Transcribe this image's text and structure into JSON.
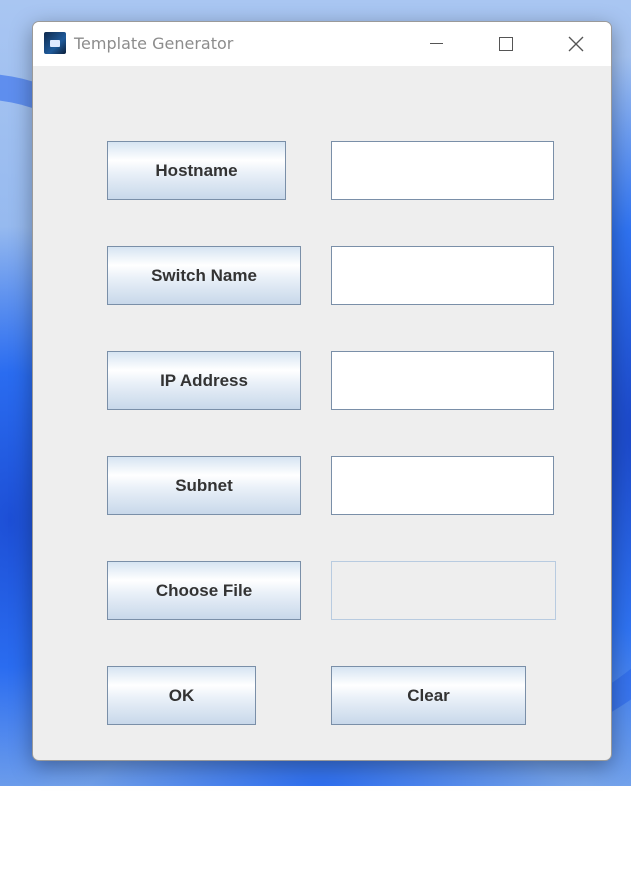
{
  "window": {
    "title": "Template Generator"
  },
  "form": {
    "hostname_label": "Hostname",
    "hostname_value": "",
    "switch_name_label": "Switch Name",
    "switch_name_value": "",
    "ip_address_label": "IP Address",
    "ip_address_value": "",
    "subnet_label": "Subnet",
    "subnet_value": "",
    "choose_file_label": "Choose File",
    "chosen_file_value": ""
  },
  "actions": {
    "ok_label": "OK",
    "clear_label": "Clear"
  },
  "icons": {
    "app": "template-generator-app-icon",
    "minimize": "minimize-icon",
    "maximize": "maximize-icon",
    "close": "close-icon"
  },
  "colors": {
    "window_background": "#eeeeee",
    "titlebar_background": "#ffffff",
    "button_text": "#333333",
    "button_border": "#7a8fa8",
    "desktop_accent": "#2a6cf0"
  }
}
